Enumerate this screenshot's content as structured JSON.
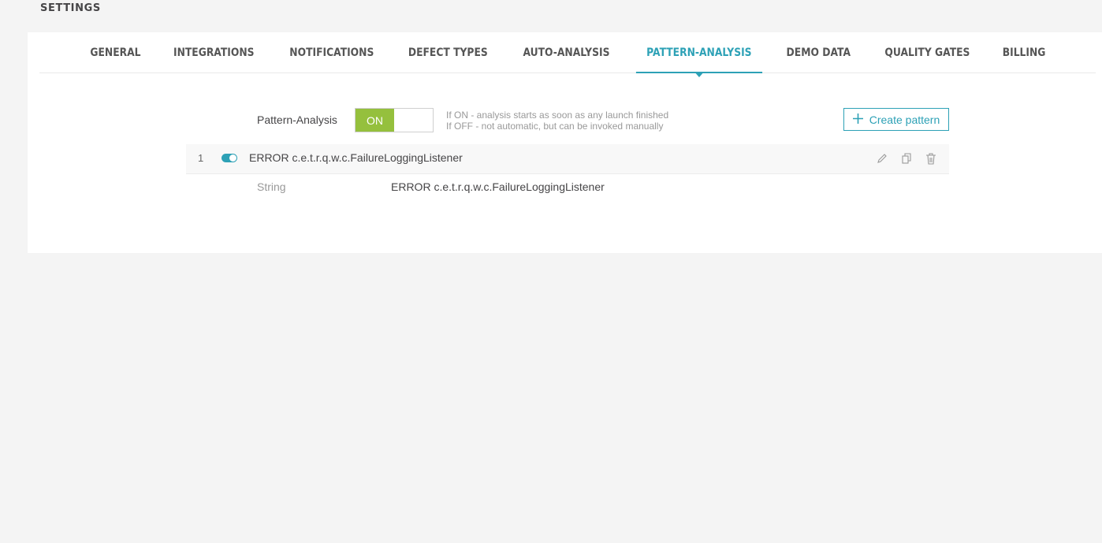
{
  "page": {
    "title": "SETTINGS"
  },
  "tabs": [
    {
      "label": "GENERAL"
    },
    {
      "label": "INTEGRATIONS"
    },
    {
      "label": "NOTIFICATIONS"
    },
    {
      "label": "DEFECT TYPES"
    },
    {
      "label": "AUTO-ANALYSIS"
    },
    {
      "label": "PATTERN-ANALYSIS",
      "active": true
    },
    {
      "label": "DEMO DATA"
    },
    {
      "label": "QUALITY GATES"
    },
    {
      "label": "BILLING"
    }
  ],
  "pattern_analysis": {
    "label": "Pattern-Analysis",
    "toggle_state": "ON",
    "hint_on": "If ON - analysis starts as soon as any launch finished",
    "hint_off": "If OFF - not automatic, but can be invoked manually",
    "create_button": "Create pattern"
  },
  "patterns": [
    {
      "index": "1",
      "enabled": true,
      "name": "ERROR c.e.t.r.q.w.c.FailureLoggingListener",
      "type_label": "String",
      "value": "ERROR c.e.t.r.q.w.c.FailureLoggingListener"
    }
  ],
  "colors": {
    "accent": "#2da1b6",
    "toggle_on": "#95c03d"
  },
  "icons": [
    "plus-icon",
    "pencil-icon",
    "copy-icon",
    "trash-icon"
  ]
}
